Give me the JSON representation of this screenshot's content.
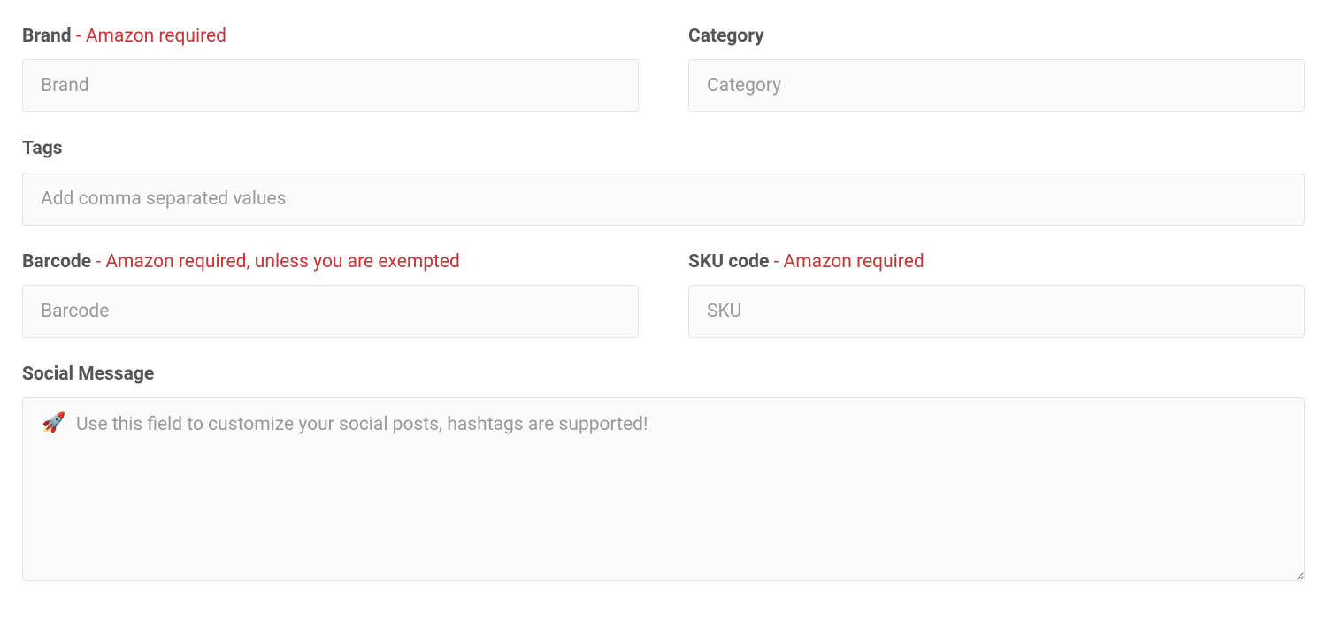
{
  "brand": {
    "label": "Brand",
    "hint": " - Amazon required",
    "placeholder": "Brand",
    "value": ""
  },
  "category": {
    "label": "Category",
    "placeholder": "Category",
    "value": ""
  },
  "tags": {
    "label": "Tags",
    "placeholder": "Add comma separated values",
    "value": ""
  },
  "barcode": {
    "label": "Barcode",
    "hint": " - Amazon required, unless you are exempted",
    "placeholder": "Barcode",
    "value": ""
  },
  "sku": {
    "label": "SKU code",
    "hint": " - Amazon required",
    "placeholder": "SKU",
    "value": ""
  },
  "social": {
    "label": "Social Message",
    "placeholder": "Use this field to customize your social posts, hashtags are supported!",
    "value": "",
    "icon": "🚀"
  }
}
